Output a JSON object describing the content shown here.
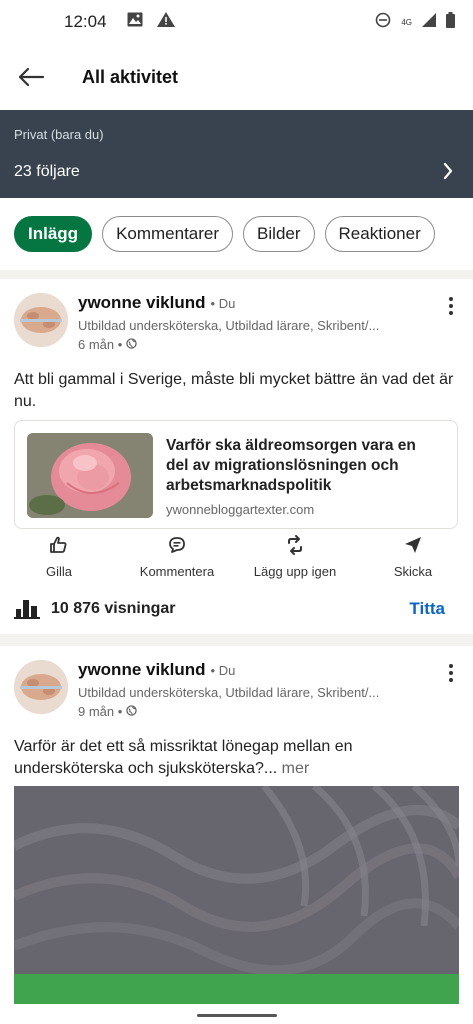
{
  "status": {
    "time": "12:04",
    "network": "4G"
  },
  "header": {
    "title": "All aktivitet"
  },
  "privacy": {
    "label": "Privat (bara du)",
    "followers": "23 följare"
  },
  "filters": [
    {
      "label": "Inlägg",
      "active": true
    },
    {
      "label": "Kommentarer",
      "active": false
    },
    {
      "label": "Bilder",
      "active": false
    },
    {
      "label": "Reaktioner",
      "active": false
    }
  ],
  "posts": [
    {
      "author": "ywonne viklund",
      "badge": "• Du",
      "headline": "Utbildad undersköterska, Utbildad lärare, Skribent/...",
      "time": "6 mån •",
      "text": "Att bli gammal i Sverige, måste bli mycket bättre än vad det är nu.",
      "link": {
        "title": "Varför ska äldreomsorgen vara en del av migrationslösningen och arbetsmarknadspolitik",
        "domain": "ywonnebloggartexter.com"
      },
      "actions": {
        "like": "Gilla",
        "comment": "Kommentera",
        "repost": "Lägg upp igen",
        "send": "Skicka"
      },
      "views": "10 876 visningar",
      "view_button": "Titta"
    },
    {
      "author": "ywonne viklund",
      "badge": "• Du",
      "headline": "Utbildad undersköterska, Utbildad lärare, Skribent/...",
      "time": "9 mån •",
      "text": "Varför är det ett så missriktat lönegap mellan en undersköterska och sjuksköterska?...",
      "more": " mer"
    }
  ],
  "colors": {
    "accent_green": "#057642",
    "link_blue": "#0a66c2",
    "privacy_bar": "#38434f"
  }
}
